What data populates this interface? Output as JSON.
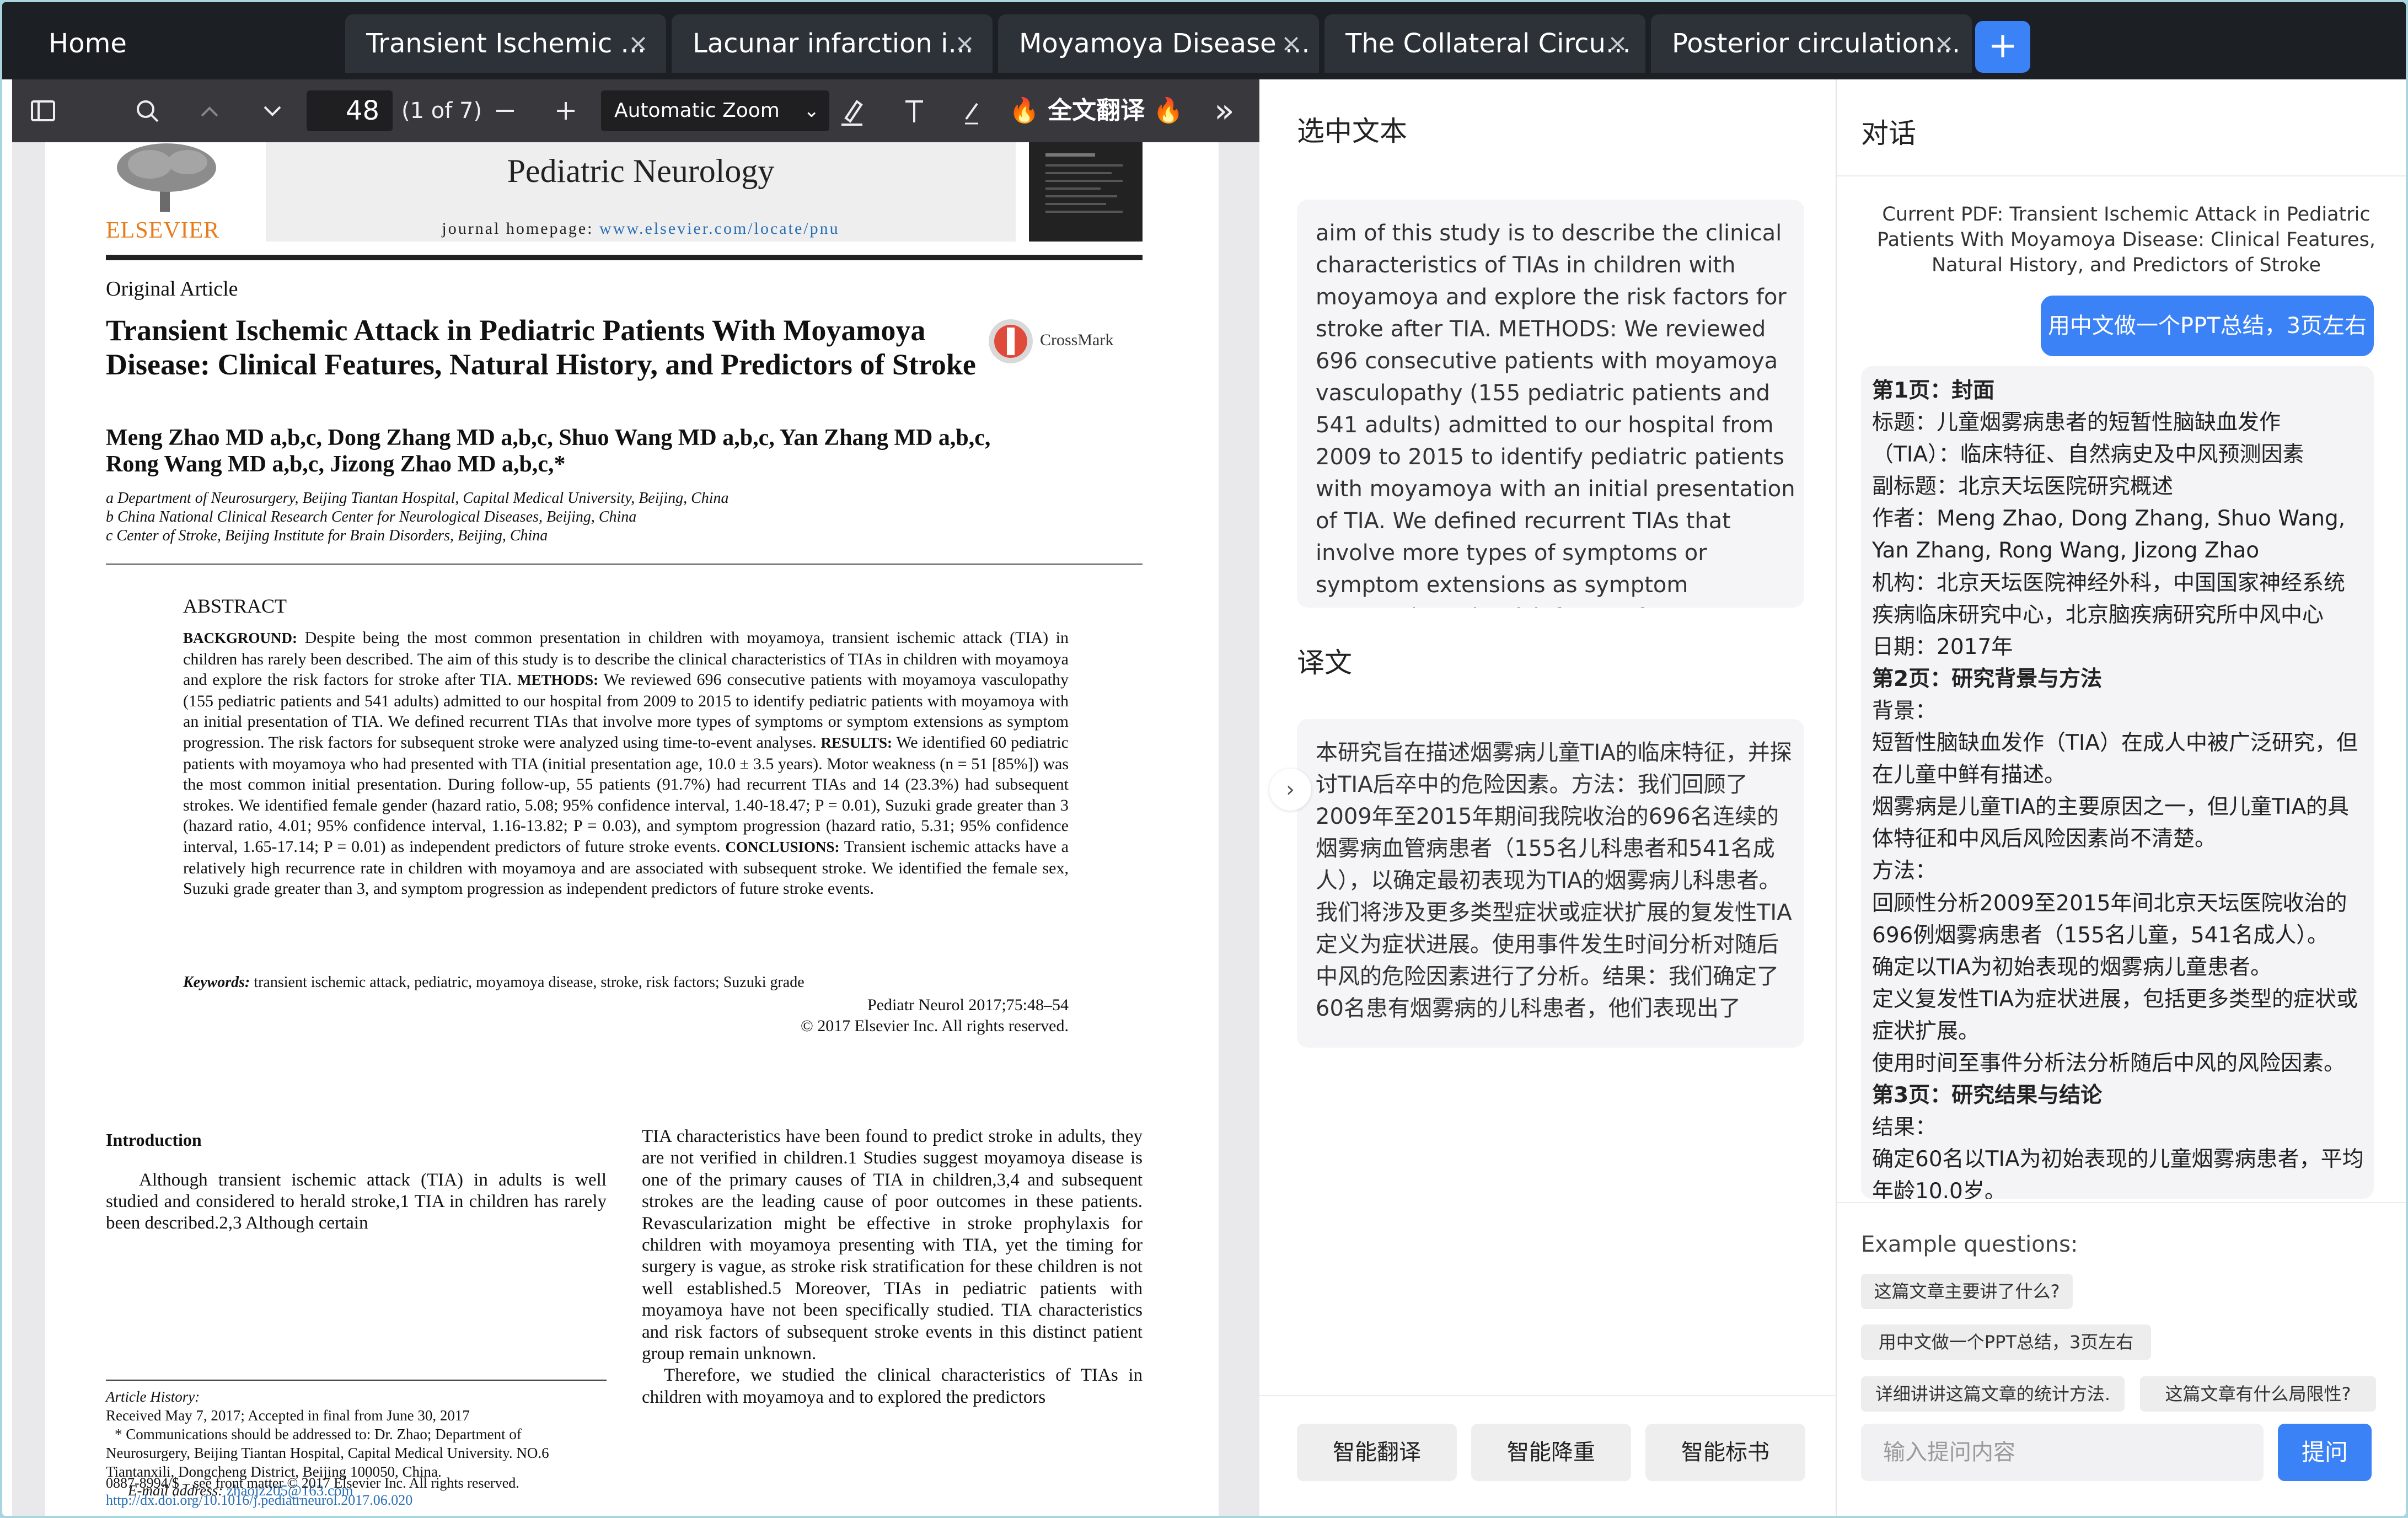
{
  "tabs": [
    {
      "label": "Home",
      "closable": false
    },
    {
      "label": "Transient Ischemic ...",
      "closable": true
    },
    {
      "label": "Lacunar infarction i...",
      "closable": true
    },
    {
      "label": "Moyamoya Disease ...",
      "closable": true
    },
    {
      "label": "The Collateral Circu...",
      "closable": true
    },
    {
      "label": "Posterior circulation...",
      "closable": true
    }
  ],
  "add_tab": "+",
  "close_glyph": "×",
  "pdf_toolbar": {
    "page_number": "48",
    "page_count": "(1 of 7)",
    "zoom": "Automatic Zoom",
    "translate_label": "🔥 全文翻译 🔥",
    "more": "»"
  },
  "pdf": {
    "journal_title": "Pediatric Neurology",
    "journal_homepage_prefix": "journal homepage: ",
    "journal_homepage_url": "www.elsevier.com/locate/pnu",
    "publisher_logo": "ELSEVIER",
    "crossmark": "CrossMark",
    "article_type": "Original Article",
    "title": "Transient Ischemic Attack in Pediatric Patients With Moyamoya Disease: Clinical Features, Natural History, and Predictors of Stroke",
    "authors_line1": "Meng Zhao MD a,b,c, Dong Zhang MD a,b,c, Shuo Wang MD a,b,c, Yan Zhang MD a,b,c,",
    "authors_line2": "Rong Wang MD a,b,c, Jizong Zhao MD a,b,c,*",
    "affiliations": [
      "a Department of Neurosurgery, Beijing Tiantan Hospital, Capital Medical University, Beijing, China",
      "b China National Clinical Research Center for Neurological Diseases, Beijing, China",
      "c Center of Stroke, Beijing Institute for Brain Disorders, Beijing, China"
    ],
    "abstract_heading": "ABSTRACT",
    "abstract_background_label": "BACKGROUND:",
    "abstract_background": " Despite being the most common presentation in children with moyamoya, transient ischemic attack (TIA) in children has rarely been described. The aim of this study is to describe the clinical characteristics of TIAs in children with moyamoya and explore the risk factors for stroke after TIA. ",
    "abstract_methods_label": "METHODS:",
    "abstract_methods": " We reviewed 696 consecutive patients with moyamoya vasculopathy (155 pediatric patients and 541 adults) admitted to our hospital from 2009 to 2015 to identify pediatric patients with moyamoya with an initial presentation of TIA. We defined recurrent TIAs that involve more types of symptoms or symptom extensions as symptom progression. The risk factors for subsequent stroke were analyzed using time-to-event analyses. ",
    "abstract_results_label": "RESULTS:",
    "abstract_results": " We identified 60 pediatric patients with moyamoya who had presented with TIA (initial presentation age, 10.0 ± 3.5 years). Motor weakness (n = 51 [85%]) was the most common initial presentation. During follow-up, 55 patients (91.7%) had recurrent TIAs and 14 (23.3%) had subsequent strokes. We identified female gender (hazard ratio, 5.08; 95% confidence interval, 1.40-18.47; P = 0.01), Suzuki grade greater than 3 (hazard ratio, 4.01; 95% confidence interval, 1.16-13.82; P = 0.03), and symptom progression (hazard ratio, 5.31; 95% confidence interval, 1.65-17.14; P = 0.01) as independent predictors of future stroke events. ",
    "abstract_conclusions_label": "CONCLUSIONS:",
    "abstract_conclusions": " Transient ischemic attacks have a relatively high recurrence rate in children with moyamoya and are associated with subsequent stroke. We identified the female sex, Suzuki grade greater than 3, and symptom progression as independent predictors of future stroke events.",
    "keywords_label": "Keywords:",
    "keywords": " transient ischemic attack, pediatric, moyamoya disease, stroke, risk factors; Suzuki grade",
    "citation": "Pediatr Neurol 2017;75:48–54",
    "copyright": "© 2017 Elsevier Inc. All rights reserved.",
    "intro_heading": "Introduction",
    "intro_left": "Although transient ischemic attack (TIA) in adults is well studied and considered to herald stroke,1 TIA in children has rarely been described.2,3 Although certain",
    "intro_right_p1": "TIA characteristics have been found to predict stroke in adults, they are not verified in children.1 Studies suggest moyamoya disease is one of the primary causes of TIA in children,3,4 and subsequent strokes are the leading cause of poor outcomes in these patients. Revascularization might be effective in stroke prophylaxis for children with moyamoya presenting with TIA, yet the timing for surgery is vague, as stroke risk stratification for these children is not well established.5 Moreover, TIAs in pediatric patients with moyamoya have not been specifically studied. TIA characteristics and risk factors of subsequent stroke events in this distinct patient group remain unknown.",
    "intro_right_p2": "Therefore, we studied the clinical characteristics of TIAs in children with moyamoya and to explored the predictors",
    "history_label": "Article History:",
    "history_dates": "Received May 7, 2017; Accepted in final from June 30, 2017",
    "correspondence": "* Communications should be addressed to: Dr. Zhao; Department of Neurosurgery, Beijing Tiantan Hospital, Capital Medical University. NO.6 Tiantanxili, Dongcheng District, Beijing 100050, China.",
    "email_label": "E-mail address: ",
    "email": "zhaojz205@163.com",
    "issn": "0887-8994/$ – see front matter © 2017 Elsevier Inc. All rights reserved.",
    "doi": "http://dx.doi.org/10.1016/j.pediatrneurol.2017.06.020"
  },
  "middle": {
    "selected_title": "选中文本",
    "selected_text": "aim of this study is to describe the clinical characteristics of TIAs in children with moyamoya and explore the risk factors for stroke after TIA. METHODS: We reviewed 696 consecutive patients with moyamoya vasculopathy (155 pediatric patients and 541 adults) admitted to our hospital from 2009 to 2015 to identify pediatric patients with moyamoya with an initial presentation of TIA. We defined recurrent TIAs that involve more types of symptoms or symptom extensions as symptom progression. The risk factors for",
    "translation_title": "译文",
    "translation_text": "本研究旨在描述烟雾病儿童TIA的临床特征，并探讨TIA后卒中的危险因素。方法：我们回顾了2009年至2015年期间我院收治的696名连续的烟雾病血管病患者（155名儿科患者和541名成人），以确定最初表现为TIA的烟雾病儿科患者。我们将涉及更多类型症状或症状扩展的复发性TIA定义为症状进展。使用事件发生时间分析对随后中风的危险因素进行了分析。结果：我们确定了60名患有烟雾病的儿科患者，他们表现出了",
    "collapse_glyph": "›",
    "buttons": [
      "智能翻译",
      "智能降重",
      "智能标书"
    ]
  },
  "chat": {
    "title": "对话",
    "current_pdf": "Current PDF: Transient Ischemic Attack in Pediatric Patients With Moyamoya Disease: Clinical Features, Natural History, and Predictors of Stroke",
    "user_message": "用中文做一个PPT总结，3页左右",
    "reply_lines": [
      {
        "text": "第1页：封面",
        "bold": true
      },
      {
        "text": "标题：儿童烟雾病患者的短暂性脑缺血发作",
        "bold": false
      },
      {
        "text": "（TIA）：临床特征、自然病史及中风预测因素",
        "bold": false
      },
      {
        "text": "副标题：北京天坛医院研究概述",
        "bold": false
      },
      {
        "text": "作者：Meng Zhao, Dong Zhang, Shuo Wang,",
        "bold": false
      },
      {
        "text": "Yan Zhang, Rong Wang, Jizong Zhao",
        "bold": false
      },
      {
        "text": "机构：北京天坛医院神经外科，中国国家神经系统",
        "bold": false
      },
      {
        "text": "疾病临床研究中心，北京脑疾病研究所中风中心",
        "bold": false
      },
      {
        "text": "日期：2017年",
        "bold": false
      },
      {
        "text": "第2页：研究背景与方法",
        "bold": true
      },
      {
        "text": "背景：",
        "bold": false
      },
      {
        "text": "短暂性脑缺血发作（TIA）在成人中被广泛研究，但",
        "bold": false
      },
      {
        "text": "在儿童中鲜有描述。",
        "bold": false
      },
      {
        "text": "烟雾病是儿童TIA的主要原因之一，但儿童TIA的具",
        "bold": false
      },
      {
        "text": "体特征和中风后风险因素尚不清楚。",
        "bold": false
      },
      {
        "text": "方法：",
        "bold": false
      },
      {
        "text": "回顾性分析2009至2015年间北京天坛医院收治的",
        "bold": false
      },
      {
        "text": "696例烟雾病患者（155名儿童，541名成人）。",
        "bold": false
      },
      {
        "text": "确定以TIA为初始表现的烟雾病儿童患者。",
        "bold": false
      },
      {
        "text": "定义复发性TIA为症状进展，包括更多类型的症状或",
        "bold": false
      },
      {
        "text": "症状扩展。",
        "bold": false
      },
      {
        "text": "使用时间至事件分析法分析随后中风的风险因素。",
        "bold": false
      },
      {
        "text": "第3页：研究结果与结论",
        "bold": true
      },
      {
        "text": "结果：",
        "bold": false
      },
      {
        "text": "确定60名以TIA为初始表现的儿童烟雾病患者，平均",
        "bold": false
      },
      {
        "text": "年龄10.0岁。",
        "bold": false
      }
    ],
    "examples_label": "Example questions:",
    "examples": [
      "这篇文章主要讲了什么?",
      "用中文做一个PPT总结，3页左右",
      "详细讲讲这篇文章的统计方法.",
      "这篇文章有什么局限性?"
    ],
    "input_placeholder": "输入提问内容",
    "ask_label": "提问"
  }
}
